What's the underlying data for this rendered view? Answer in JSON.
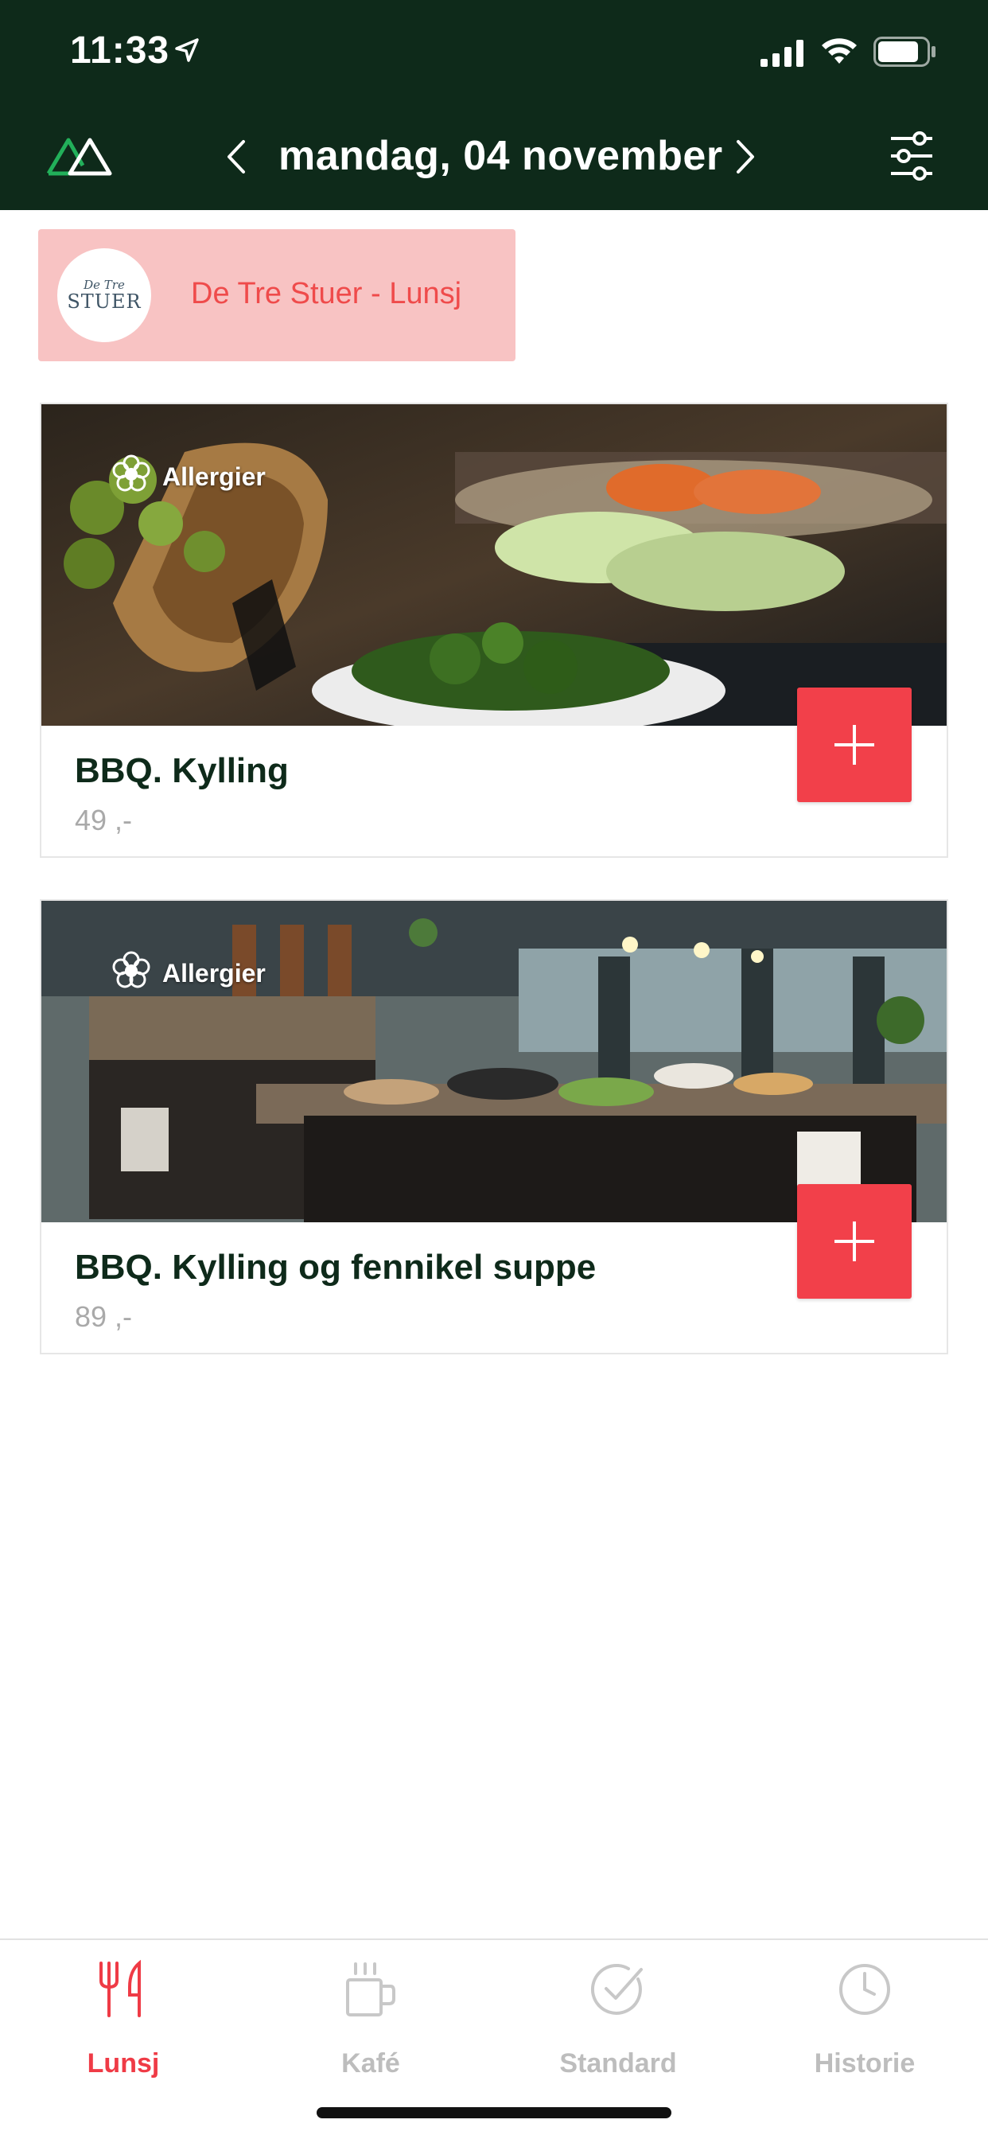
{
  "status_bar": {
    "time": "11:33"
  },
  "header": {
    "date": "mandag, 04 november"
  },
  "restaurant": {
    "label": "De Tre Stuer - Lunsj",
    "logo_small": "De Tre",
    "logo_big": "STUER"
  },
  "items": [
    {
      "name": "BBQ. Kylling",
      "price": "49 ,-",
      "allergy_label": "Allergier"
    },
    {
      "name": "BBQ. Kylling og fennikel suppe",
      "price": "89 ,-",
      "allergy_label": "Allergier"
    }
  ],
  "tabs": [
    {
      "label": "Lunsj",
      "icon": "cutlery-icon",
      "active": true
    },
    {
      "label": "Kafé",
      "icon": "coffee-cup-icon",
      "active": false
    },
    {
      "label": "Standard",
      "icon": "check-circle-icon",
      "active": false
    },
    {
      "label": "Historie",
      "icon": "clock-icon",
      "active": false
    }
  ],
  "colors": {
    "header_bg": "#0e2a1a",
    "accent_red": "#f2404a",
    "chip_bg": "#f8c3c3",
    "inactive_tab": "#bdbdbd"
  }
}
